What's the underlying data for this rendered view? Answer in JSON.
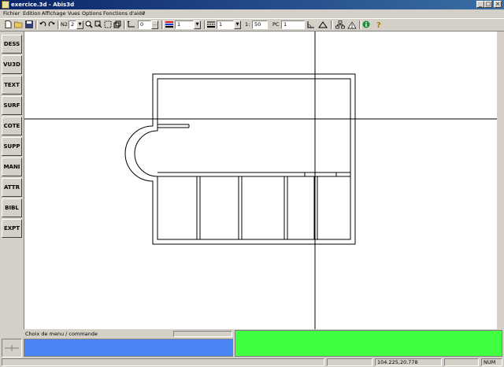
{
  "window": {
    "title": "exercice.3d - Abis3d",
    "controls": {
      "minimize": "_",
      "maximize": "□",
      "close": "×"
    }
  },
  "menu": [
    "Fichier",
    "Edition",
    "Affichage",
    "Vues",
    "Options",
    "Fonctions d'aide",
    "?"
  ],
  "toolbar": {
    "level_label": "N2",
    "level_value": "2",
    "spacing_value": "0",
    "color_value": "1",
    "linetype_value": "1",
    "scale_prefix": "1:",
    "scale_value": "50",
    "pc_label": "PC",
    "pc_value": "1"
  },
  "sidebar": [
    "DESS",
    "VU3D",
    "TEXT",
    "SURF",
    "COTE",
    "SUPP",
    "MANI",
    "ATTR",
    "BIBL",
    "EXPT"
  ],
  "command": {
    "label": "Choix de menu / commande"
  },
  "status": {
    "coordinates": "104.225,20.778",
    "num": "NUM"
  },
  "colors": {
    "titlebar": "#0a246a",
    "command_panel": "#4a85f5",
    "message_panel": "#40ff40",
    "canvas": "#ffffff"
  }
}
